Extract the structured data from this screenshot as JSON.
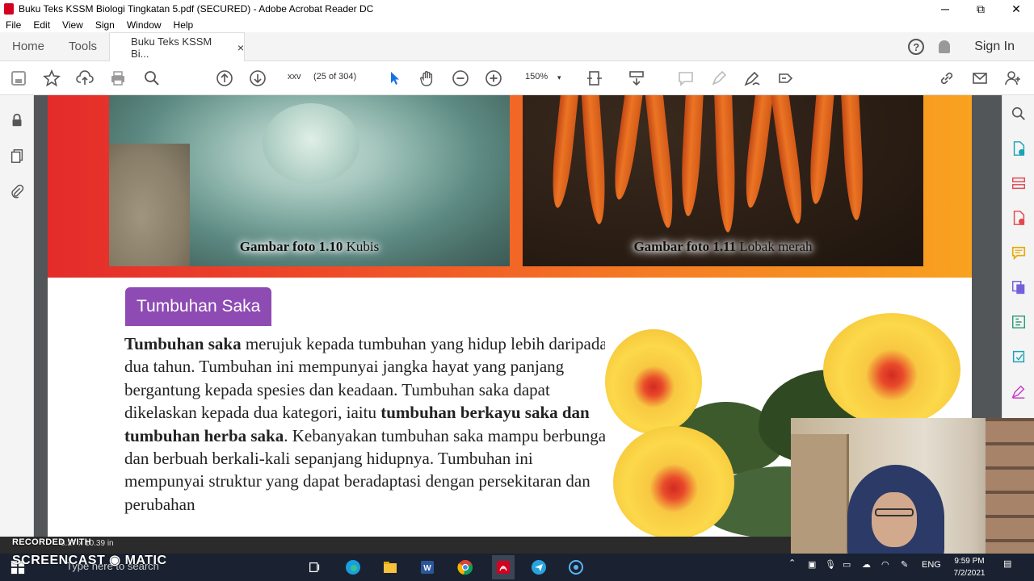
{
  "window": {
    "title": "Buku Teks KSSM Biologi Tingkatan 5.pdf (SECURED) - Adobe Acrobat Reader DC",
    "minimize": "─",
    "maximize": "⧉",
    "close": "✕"
  },
  "menu": [
    "File",
    "Edit",
    "View",
    "Sign",
    "Window",
    "Help"
  ],
  "tabs": {
    "home": "Home",
    "tools": "Tools",
    "document": "Buku Teks KSSM Bi...",
    "close": "×",
    "help": "?",
    "sign_in": "Sign In"
  },
  "toolbar": {
    "page_label": "xxv",
    "page_count": "(25 of 304)",
    "zoom": "150%"
  },
  "page": {
    "caption_cabbage_bold": "Gambar foto 1.10",
    "caption_cabbage_text": " Kubis",
    "caption_carrot_bold": "Gambar foto 1.11",
    "caption_carrot_text": " Lobak merah",
    "section_heading": "Tumbuhan Saka",
    "para_bold_1": "Tumbuhan saka",
    "para_text_1": " merujuk kepada tumbuhan yang hidup lebih daripada dua tahun. Tumbuhan ini mempunyai jangka hayat yang panjang bergantung kepada spesies dan keadaan. Tumbuhan saka dapat dikelaskan kepada dua kategori, iaitu ",
    "para_bold_2": "tumbuhan berkayu saka dan tumbuhan herba saka",
    "para_text_2": ". Kebanyakan tumbuhan saka mampu berbunga dan berbuah berkali-kali sepanjang hidupnya. Tumbuhan ini mempunyai struktur yang dapat beradaptasi dengan persekitaran dan perubahan"
  },
  "status": {
    "dimensions": "8.27 x 10.39 in"
  },
  "overlay": {
    "recorded_with": "RECORDED WITH",
    "brand": "SCREENCAST ◉ MATIC"
  },
  "taskbar": {
    "search_placeholder": "Type here to search",
    "language": "ENG",
    "time": "9:59 PM",
    "date": "7/2/2021"
  },
  "colors": {
    "heading_bg": "#8e4bb3",
    "banner_start": "#e42b2b",
    "banner_end": "#f8a21f",
    "acrobat_red": "#d4001f",
    "select_blue": "#1473e6"
  }
}
